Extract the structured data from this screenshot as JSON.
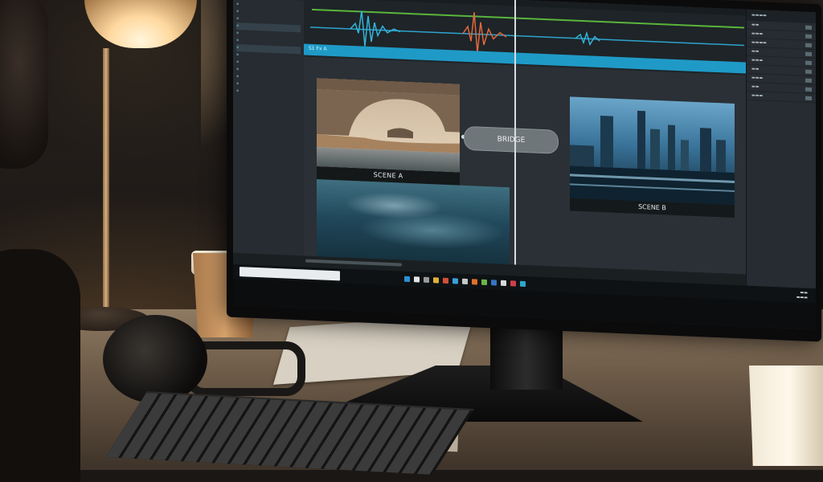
{
  "scene": {
    "description_colors": {
      "screen_bg": "#20262b",
      "timeline_track": "#1f9ac7",
      "waveform_a": "#34b3d9",
      "waveform_b": "#e0683e",
      "waveform_c": "#34b3d9",
      "accent_green": "#5ab53c"
    }
  },
  "editor": {
    "timeline": {
      "track_label": "S1 Fx A"
    },
    "viewer": {
      "scene_a_label": "SCENE A",
      "bridge_label": "BRIDGE",
      "scene_b_label": "SCENE B"
    }
  }
}
